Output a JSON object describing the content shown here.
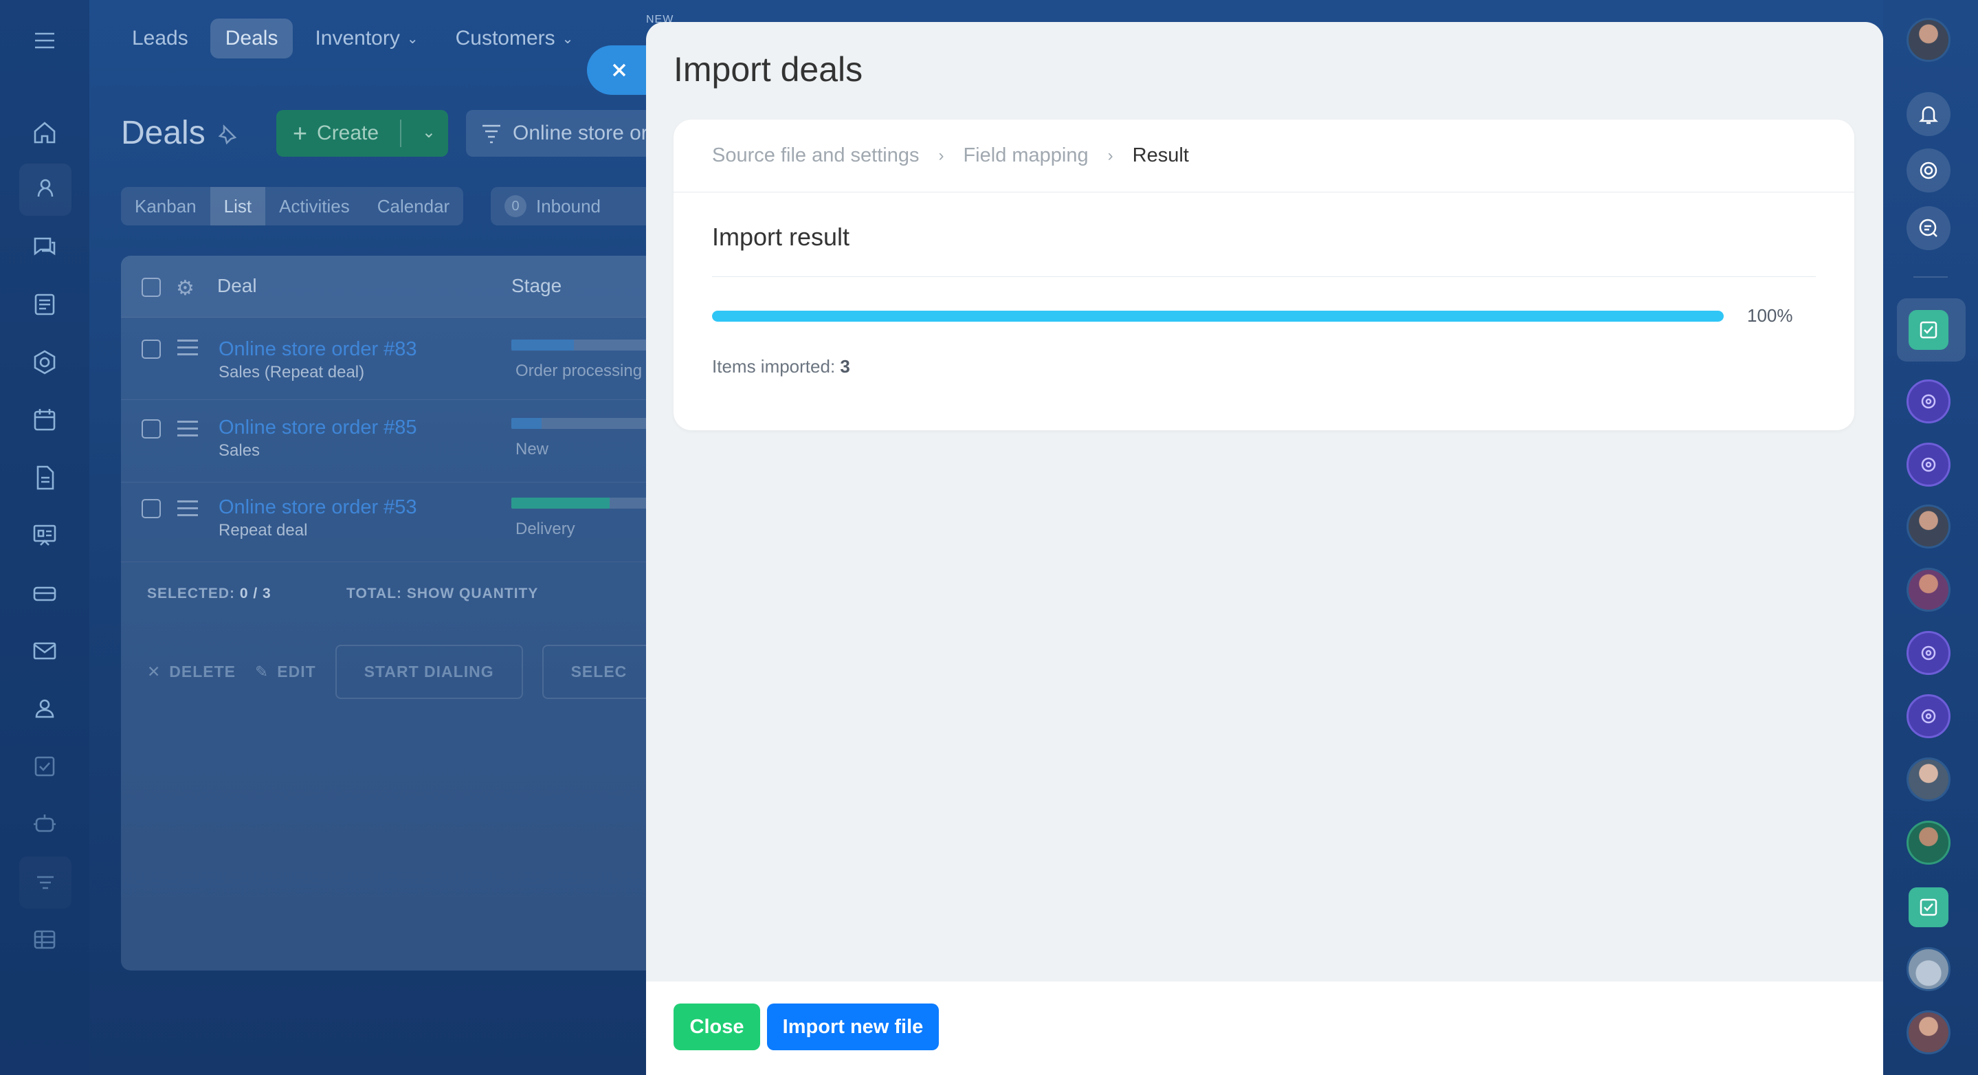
{
  "topnav": {
    "tabs": [
      {
        "label": "Leads"
      },
      {
        "label": "Deals"
      },
      {
        "label": "Inventory"
      },
      {
        "label": "Customers"
      }
    ],
    "new_badge": "NEW"
  },
  "page": {
    "title": "Deals",
    "create_label": "Create",
    "filter_label": "Online store orders",
    "view_tabs": [
      "Kanban",
      "List",
      "Activities",
      "Calendar"
    ],
    "counter": {
      "count": "0",
      "label": "Inbound"
    }
  },
  "grid": {
    "columns": {
      "deal": "Deal",
      "stage": "Stage"
    },
    "rows": [
      {
        "title": "Online store order #83",
        "subtitle": "Sales (Repeat deal)",
        "stage": "Order processing",
        "progress": 0.35
      },
      {
        "title": "Online store order #85",
        "subtitle": "Sales",
        "stage": "New",
        "progress": 0.17
      },
      {
        "title": "Online store order #53",
        "subtitle": "Repeat deal",
        "stage": "Delivery",
        "progress": 0.55
      }
    ],
    "footer": {
      "selected_label": "SELECTED:",
      "selected_value": "0 / 3",
      "total_label": "TOTAL:",
      "total_value": "SHOW QUANTITY"
    },
    "actions": {
      "delete": "DELETE",
      "edit": "EDIT",
      "start_dialing": "START DIALING",
      "select": "SELEC"
    }
  },
  "import": {
    "title": "Import deals",
    "steps": [
      "Source file and settings",
      "Field mapping",
      "Result"
    ],
    "result_title": "Import result",
    "progress_percent": 100,
    "progress_label": "100%",
    "imported_label": "Items imported:",
    "imported_count": "3",
    "buttons": {
      "close": "Close",
      "import_new": "Import new file"
    },
    "colors": {
      "progress": "#2fc6f6",
      "close_button": "#1fce74",
      "import_button": "#0b7bff"
    }
  }
}
